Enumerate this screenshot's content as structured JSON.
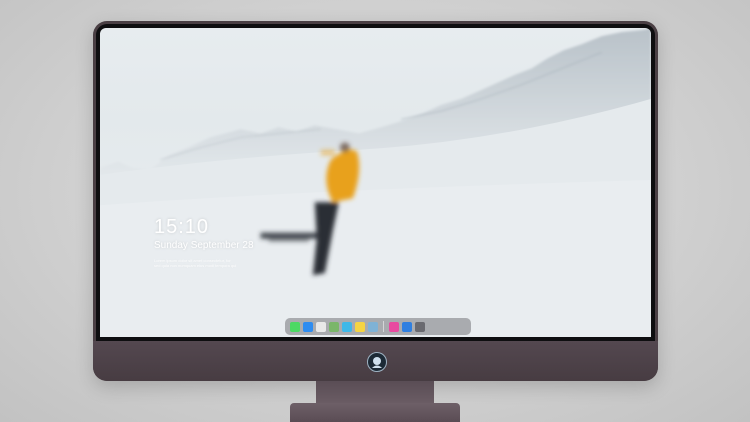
{
  "lock_screen": {
    "time": "15:10",
    "date": "Sunday September 28",
    "caption_line1": "Lorem ipsum dolor sit amet consectetur, for",
    "caption_line2": "sed quia non numquam eius modi tempora qui"
  },
  "dock": {
    "items": [
      {
        "name": "messages-icon",
        "color": "#4cd964"
      },
      {
        "name": "finder-icon",
        "color": "#2e8cf0"
      },
      {
        "name": "safari-icon",
        "color": "#e8e8e8"
      },
      {
        "name": "maps-icon",
        "color": "#7ab66a"
      },
      {
        "name": "files-icon",
        "color": "#3fb8e8"
      },
      {
        "name": "notes-icon",
        "color": "#f5d442"
      },
      {
        "name": "photos-icon",
        "color": "#7fb2d6"
      },
      {
        "name": "music-icon",
        "color": "#e84aa0"
      },
      {
        "name": "app-store-icon",
        "color": "#2f7fe0"
      },
      {
        "name": "camera-icon",
        "color": "#6a6a70"
      }
    ]
  },
  "colors": {
    "bezel": "#0e0e10",
    "chassis": "#4a3f44",
    "jacket": "#e8a11e",
    "snow": "#e6ebee"
  }
}
